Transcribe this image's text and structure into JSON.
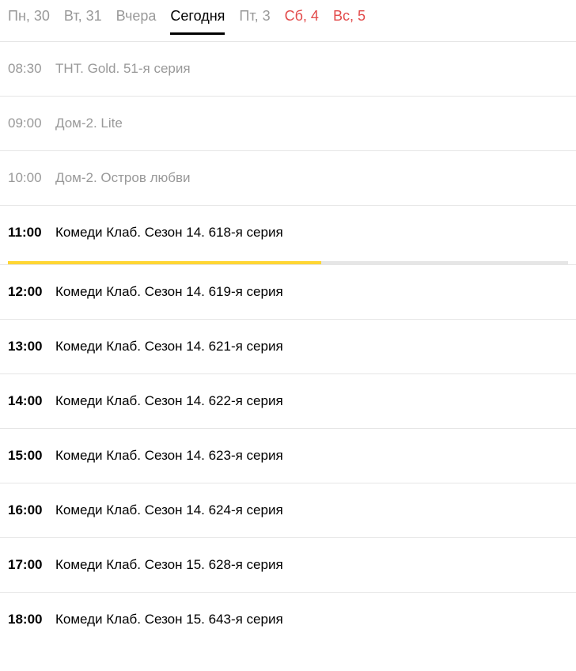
{
  "tabs": [
    {
      "label": "Пн, 30",
      "weekend": false,
      "active": false
    },
    {
      "label": "Вт, 31",
      "weekend": false,
      "active": false
    },
    {
      "label": "Вчера",
      "weekend": false,
      "active": false
    },
    {
      "label": "Сегодня",
      "weekend": false,
      "active": true
    },
    {
      "label": "Пт, 3",
      "weekend": false,
      "active": false
    },
    {
      "label": "Сб, 4",
      "weekend": true,
      "active": false
    },
    {
      "label": "Вс, 5",
      "weekend": true,
      "active": false
    }
  ],
  "schedule": [
    {
      "time": "08:30",
      "title": "ТНТ. Gold. 51-я серия",
      "state": "past"
    },
    {
      "time": "09:00",
      "title": "Дом-2. Lite",
      "state": "past"
    },
    {
      "time": "10:00",
      "title": "Дом-2. Остров любви",
      "state": "past"
    },
    {
      "time": "11:00",
      "title": "Комеди Клаб. Сезон 14. 618-я серия",
      "state": "current",
      "progress": 56
    },
    {
      "time": "12:00",
      "title": "Комеди Клаб. Сезон 14. 619-я серия",
      "state": "upcoming"
    },
    {
      "time": "13:00",
      "title": "Комеди Клаб. Сезон 14. 621-я серия",
      "state": "upcoming"
    },
    {
      "time": "14:00",
      "title": "Комеди Клаб. Сезон 14. 622-я серия",
      "state": "upcoming"
    },
    {
      "time": "15:00",
      "title": "Комеди Клаб. Сезон 14. 623-я серия",
      "state": "upcoming"
    },
    {
      "time": "16:00",
      "title": "Комеди Клаб. Сезон 14. 624-я серия",
      "state": "upcoming"
    },
    {
      "time": "17:00",
      "title": "Комеди Клаб. Сезон 15. 628-я серия",
      "state": "upcoming"
    },
    {
      "time": "18:00",
      "title": "Комеди Клаб. Сезон 15. 643-я серия",
      "state": "upcoming"
    }
  ]
}
